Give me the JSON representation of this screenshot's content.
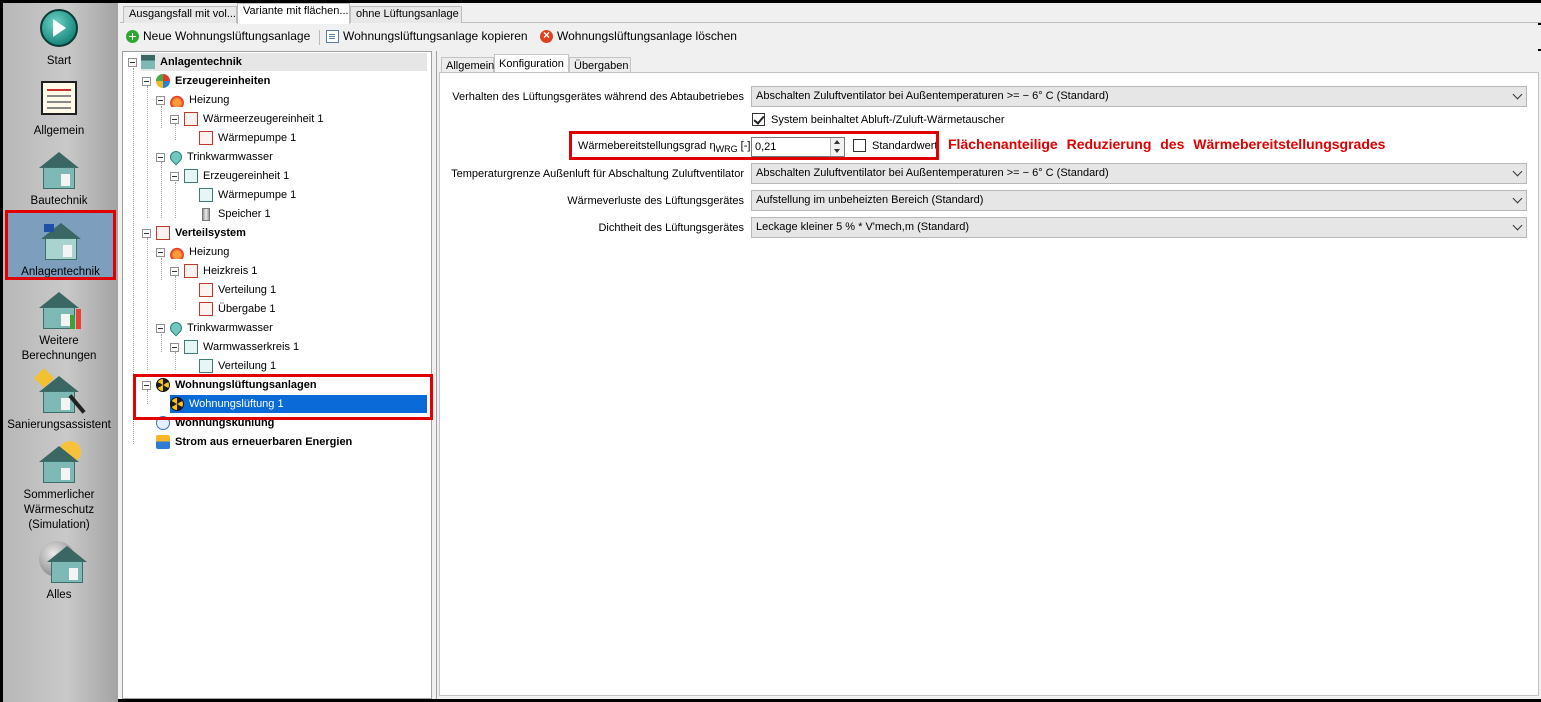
{
  "nav": {
    "items": [
      {
        "label": "Start",
        "icon": "start-icon"
      },
      {
        "label": "Allgemein",
        "icon": "notebook-icon"
      },
      {
        "label": "Bautechnik",
        "icon": "house-icon"
      },
      {
        "label": "Anlagentechnik",
        "icon": "house-system-icon",
        "selected": true
      },
      {
        "label": "Weitere Berechnungen",
        "icon": "house-chart-icon"
      },
      {
        "label": "Sanierungsassistent",
        "icon": "house-tools-icon"
      },
      {
        "label": "Sommerlicher Wärmeschutz (Simulation)",
        "icon": "house-sun-icon"
      },
      {
        "label": "Alles",
        "icon": "globe-house-icon"
      }
    ]
  },
  "doc_tabs": [
    "Ausgangsfall mit vol...",
    "Variante mit flächen...",
    "ohne Lüftungsanlage"
  ],
  "toolbar": {
    "new_label": "Neue Wohnungslüftungsanlage",
    "copy_label": "Wohnungslüftungsanlage kopieren",
    "delete_label": "Wohnungslüftungsanlage löschen"
  },
  "tree": {
    "root": "Anlagentechnik",
    "erzeuger": "Erzeugereinheiten",
    "heizung1": "Heizung",
    "waermeerzeuger": "Wärmeerzeugereinheit 1",
    "waermepumpe1": "Wärmepumpe 1",
    "trinkwarmwasser1": "Trinkwarmwasser",
    "erzeugereinheit": "Erzeugereinheit 1",
    "waermepumpe2": "Wärmepumpe 1",
    "speicher": "Speicher 1",
    "verteilsystem": "Verteilsystem",
    "heizung2": "Heizung",
    "heizkreis": "Heizkreis 1",
    "verteilung1": "Verteilung 1",
    "uebergabe": "Übergabe 1",
    "trinkwarmwasser2": "Trinkwarmwasser",
    "warmwasserkreis": "Warmwasserkreis 1",
    "verteilung2": "Verteilung 1",
    "wla": "Wohnungslüftungsanlagen",
    "wl1": "Wohnungslüftung 1",
    "kuehlung": "Wohnungskühlung",
    "strom": "Strom aus erneuerbaren Energien"
  },
  "panel_tabs": [
    "Allgemein",
    "Konfiguration",
    "Übergaben"
  ],
  "form": {
    "abtau_label": "Verhalten des Lüftungsgerätes während des Abtaubetriebes",
    "abtau_value": "Abschalten Zuluftventilator bei Außentemperaturen >= − 6° C (Standard)",
    "wrg_check_label": "System beinhaltet Abluft-/Zuluft-Wärmetauscher",
    "wrg_check_checked": true,
    "wrg_grad_label": "Wärmebereitstellungsgrad η",
    "wrg_grad_sub": "WRG",
    "wrg_grad_unit": "[-]",
    "wrg_grad_value": "0,21",
    "standardwert_label": "Standardwert",
    "standardwert_checked": false,
    "temp_label": "Temperaturgrenze Außenluft für Abschaltung Zuluftventilator",
    "temp_value": "Abschalten Zuluftventilator bei Außentemperaturen >= − 6° C (Standard)",
    "verluste_label": "Wärmeverluste des Lüftungsgerätes",
    "verluste_value": "Aufstellung im unbeheizten Bereich (Standard)",
    "dichtheit_label": "Dichtheit des Lüftungsgerätes",
    "dichtheit_value": "Leckage kleiner 5 % * V'mech,m (Standard)"
  },
  "annotation": "Flächenanteilige Reduzierung des Wärmebereitstellungsgrades",
  "colors": {
    "highlight": "#e00000",
    "selection": "#0a6ad8",
    "nav_selected": "#7d9ebd"
  }
}
